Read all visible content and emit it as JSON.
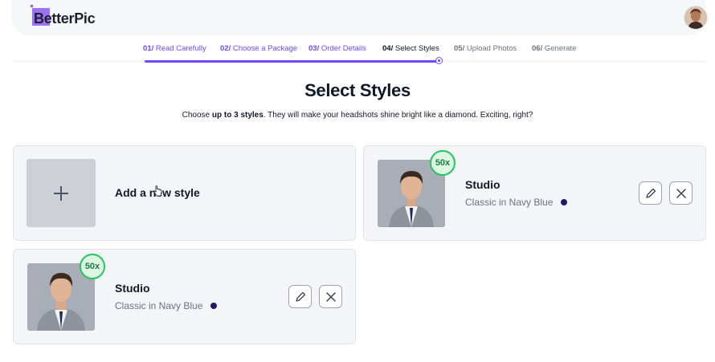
{
  "brand": {
    "name": "BetterPic",
    "accent": "#6d4aff"
  },
  "user": {
    "avatar_icon": "user-avatar"
  },
  "steps": [
    {
      "num": "01/",
      "label": "Read Carefully",
      "state": "done"
    },
    {
      "num": "02/",
      "label": "Choose a Package",
      "state": "done"
    },
    {
      "num": "03/",
      "label": "Order Details",
      "state": "done"
    },
    {
      "num": "04/",
      "label": "Select Styles",
      "state": "current"
    },
    {
      "num": "05/",
      "label": "Upload Photos",
      "state": "todo"
    },
    {
      "num": "06/",
      "label": "Generate",
      "state": "todo"
    }
  ],
  "page": {
    "title": "Select Styles",
    "subtitle_pre": "Choose ",
    "subtitle_bold": "up to 3 styles",
    "subtitle_post": ". They will make your headshots shine bright like a diamond. Exciting, right?"
  },
  "add_card": {
    "label": "Add a new style",
    "icon": "plus-icon"
  },
  "styles": [
    {
      "badge": "50x",
      "name": "Studio",
      "description": "Classic in Navy Blue",
      "color": "#1e1b6b"
    },
    {
      "badge": "50x",
      "name": "Studio",
      "description": "Classic in Navy Blue",
      "color": "#1e1b6b"
    }
  ]
}
